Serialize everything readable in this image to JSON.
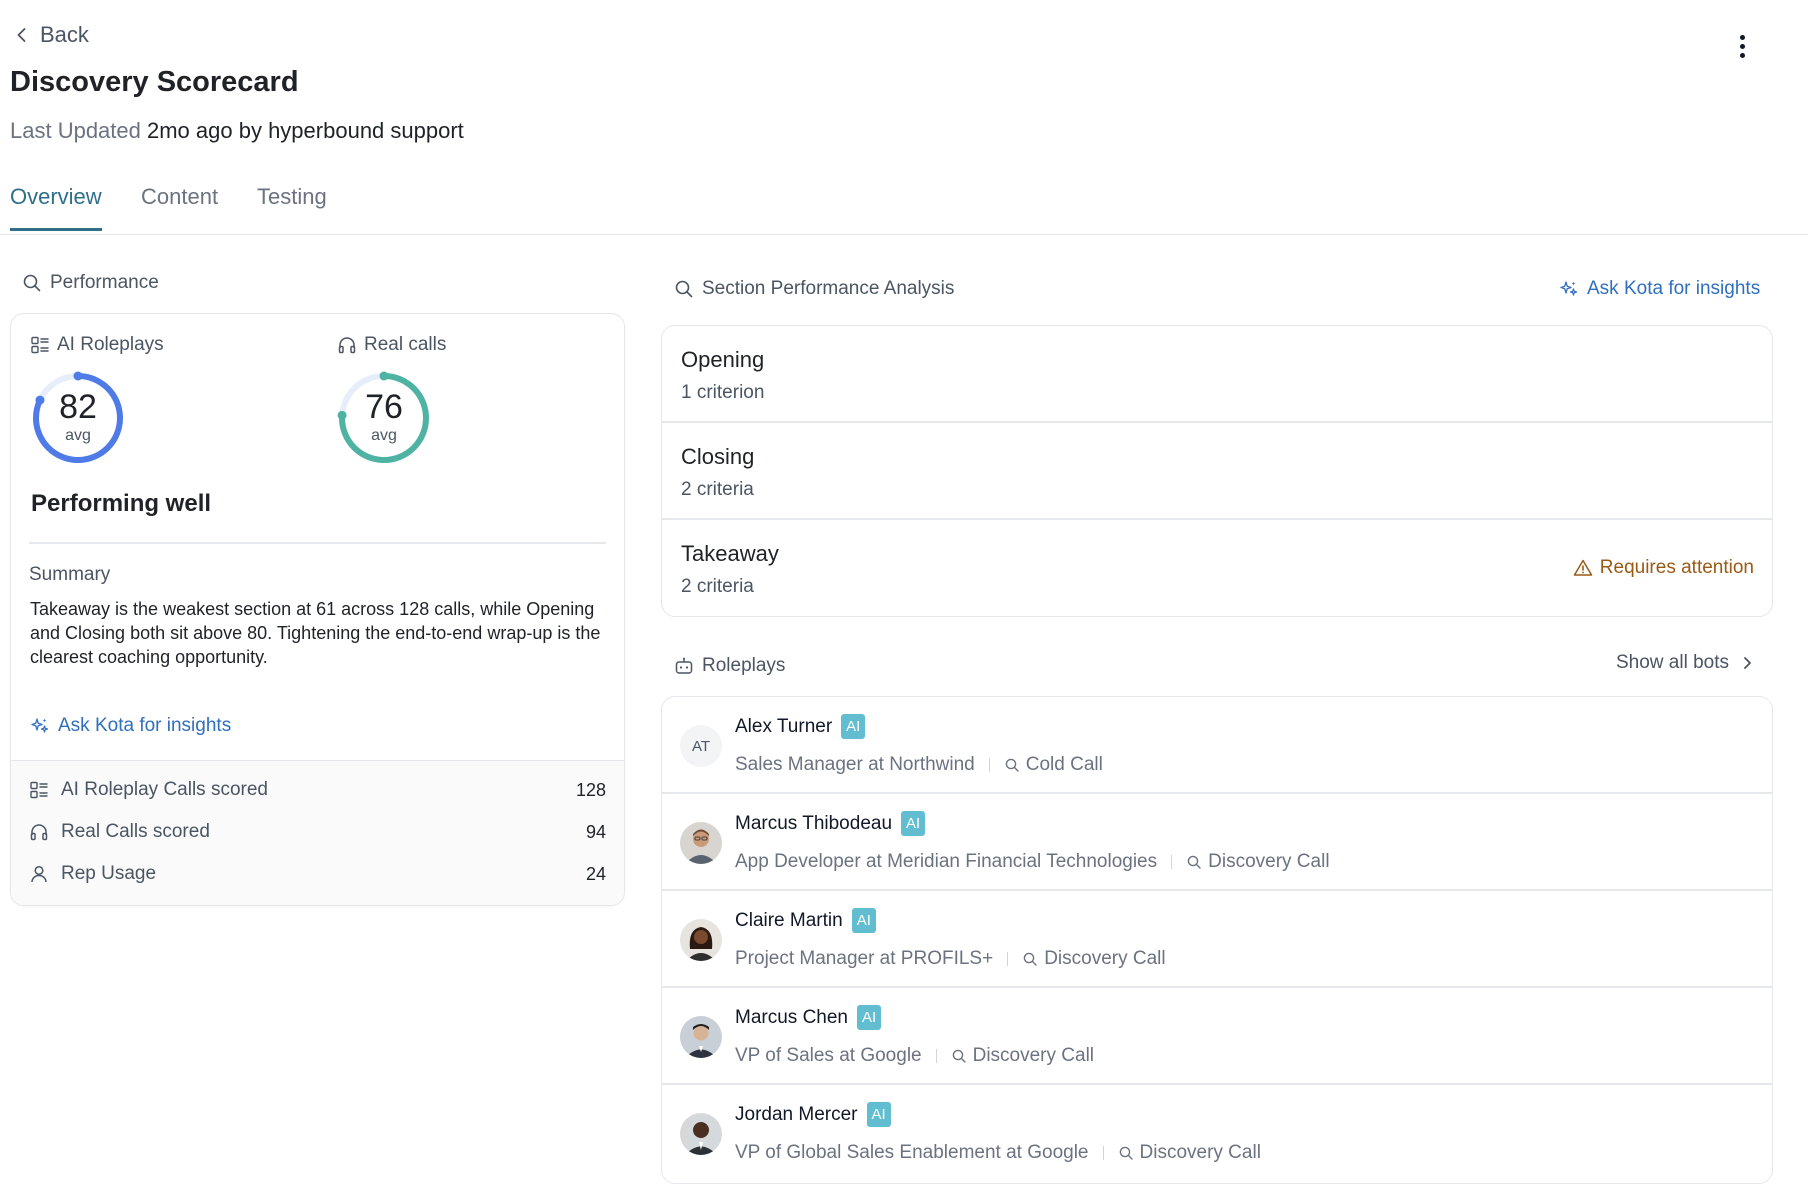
{
  "header": {
    "back_label": "Back",
    "title": "Discovery Scorecard",
    "updated_prefix": "Last Updated",
    "updated_value": "2mo ago by hyperbound support"
  },
  "tabs": [
    {
      "label": "Overview",
      "active": true
    },
    {
      "label": "Content",
      "active": false
    },
    {
      "label": "Testing",
      "active": false
    }
  ],
  "performance": {
    "section_label": "Performance",
    "ai_roleplays": {
      "label": "AI Roleplays",
      "score": "82",
      "avg_label": "avg",
      "score_value": 82,
      "ring_color": "#4f7be8"
    },
    "real_calls": {
      "label": "Real calls",
      "score": "76",
      "avg_label": "avg",
      "score_value": 76,
      "ring_color": "#4fb3a4"
    },
    "status": "Performing well",
    "summary_label": "Summary",
    "summary_text": "Takeaway is the weakest section at 61 across 128 calls, while Opening and Closing both sit above 80. Tightening the end-to-end wrap-up is the clearest coaching opportunity.",
    "ask_kota": "Ask Kota for insights",
    "stats": [
      {
        "label": "AI Roleplay Calls scored",
        "value": "128",
        "icon": "list-icon"
      },
      {
        "label": "Real Calls scored",
        "value": "94",
        "icon": "headphones-icon"
      },
      {
        "label": "Rep Usage",
        "value": "24",
        "icon": "user-icon"
      }
    ]
  },
  "section_analysis": {
    "label": "Section Performance Analysis",
    "ask_kota": "Ask Kota for insights",
    "sections": [
      {
        "name": "Opening",
        "criteria": "1 criterion",
        "attention": ""
      },
      {
        "name": "Closing",
        "criteria": "2 criteria",
        "attention": ""
      },
      {
        "name": "Takeaway",
        "criteria": "2 criteria",
        "attention": "Requires attention"
      }
    ]
  },
  "roleplays": {
    "label": "Roleplays",
    "show_all": "Show all bots",
    "bots": [
      {
        "initials": "AT",
        "name": "Alex Turner",
        "badge": "AI",
        "role": "Sales Manager at Northwind",
        "call_type": "Cold Call"
      },
      {
        "initials": "",
        "name": "Marcus Thibodeau",
        "badge": "AI",
        "role": "App Developer at Meridian Financial Technologies",
        "call_type": "Discovery Call"
      },
      {
        "initials": "",
        "name": "Claire Martin",
        "badge": "AI",
        "role": "Project Manager at PROFILS+",
        "call_type": "Discovery Call"
      },
      {
        "initials": "",
        "name": "Marcus Chen",
        "badge": "AI",
        "role": "VP of Sales at Google",
        "call_type": "Discovery Call"
      },
      {
        "initials": "",
        "name": "Jordan Mercer",
        "badge": "AI",
        "role": "VP of Global Sales Enablement at Google",
        "call_type": "Discovery Call"
      }
    ]
  }
}
